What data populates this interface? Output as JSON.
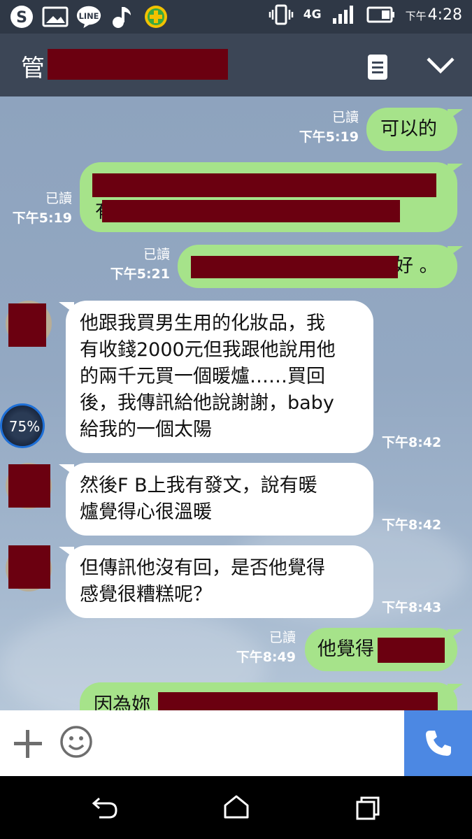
{
  "status_bar": {
    "time_prefix": "下午",
    "time": "4:28",
    "network": "4G",
    "notification_icons": [
      "skype-icon",
      "image-icon",
      "line-icon",
      "music-icon",
      "plus-app-icon"
    ]
  },
  "header": {
    "title": "管",
    "menu_icon": "note-icon",
    "collapse_icon": "chevron-down-icon"
  },
  "messages": [
    {
      "side": "me",
      "text": "可以的",
      "read": "已讀",
      "time": "下午5:19"
    },
    {
      "side": "me",
      "text": "有",
      "read": "已讀",
      "time": "下午5:19"
    },
    {
      "side": "me",
      "text": "好 。",
      "read": "已讀",
      "time": "下午5:21"
    },
    {
      "side": "them",
      "lines": [
        "他跟我買男生用的化妝品，我",
        "有收錢2000元但我跟他說用他",
        "的兩千元買一個暖爐……買回",
        "後，我傳訊給他說謝謝，baby",
        "給我的一個太陽"
      ],
      "time": "下午8:42"
    },
    {
      "side": "them",
      "lines": [
        "然後F B上我有發文，說有暖",
        "爐覺得心很溫暖"
      ],
      "time": "下午8:42"
    },
    {
      "side": "them",
      "lines": [
        "但傳訊他沒有回，是否他覺得",
        "感覺很糟糕呢？"
      ],
      "time": "下午8:43"
    },
    {
      "side": "me",
      "text": "他覺得",
      "read": "已讀",
      "time": "下午8:49"
    },
    {
      "side": "me",
      "text": "因為妳"
    }
  ],
  "overlay_badge": "75%",
  "input_bar": {
    "add_icon": "plus-icon",
    "emoji_icon": "smiley-icon",
    "call_icon": "phone-icon"
  },
  "colors": {
    "header_bg": "#3c4656",
    "my_bubble": "#a6e38a",
    "their_bubble": "#ffffff",
    "call_button": "#4c88e3",
    "redaction": "#6b0010"
  }
}
